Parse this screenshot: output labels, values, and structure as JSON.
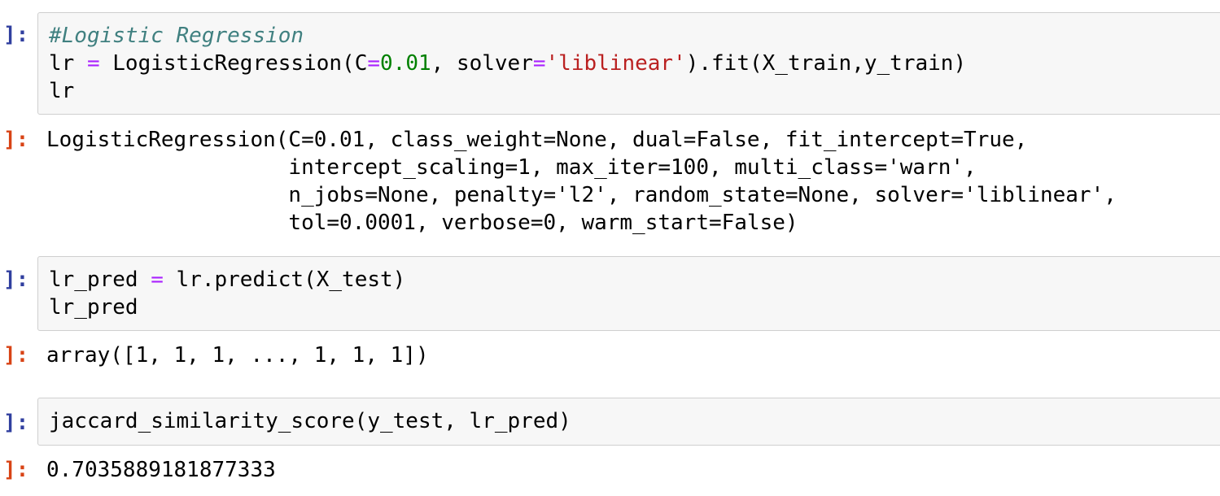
{
  "cells": [
    {
      "in_prompt": "]:",
      "code_lines": [
        {
          "comment": "#Logistic Regression"
        },
        {
          "p1": "lr ",
          "op1": "=",
          "p2": " LogisticRegression(C",
          "op2": "=",
          "num": "0.01",
          "p3": ", solver",
          "op3": "=",
          "str": "'liblinear'",
          "p4": ").fit(X_train,y_train)"
        },
        {
          "text": "lr"
        }
      ],
      "out_prompt": "]:",
      "output_lines": [
        "LogisticRegression(C=0.01, class_weight=None, dual=False, fit_intercept=True,",
        "                   intercept_scaling=1, max_iter=100, multi_class='warn',",
        "                   n_jobs=None, penalty='l2', random_state=None, solver='liblinear',",
        "                   tol=0.0001, verbose=0, warm_start=False)"
      ]
    },
    {
      "in_prompt": "]:",
      "code_lines": [
        {
          "p1": "lr_pred ",
          "op1": "=",
          "p2": " lr.predict(X_test)"
        },
        {
          "text": "lr_pred"
        }
      ],
      "out_prompt": "]:",
      "output_lines": [
        "array([1, 1, 1, ..., 1, 1, 1])"
      ]
    },
    {
      "in_prompt": "]:",
      "code_lines": [
        {
          "text": "jaccard_similarity_score(y_test, lr_pred)"
        }
      ],
      "out_prompt": "]:",
      "output_lines": [
        "0.7035889181877333"
      ]
    }
  ]
}
